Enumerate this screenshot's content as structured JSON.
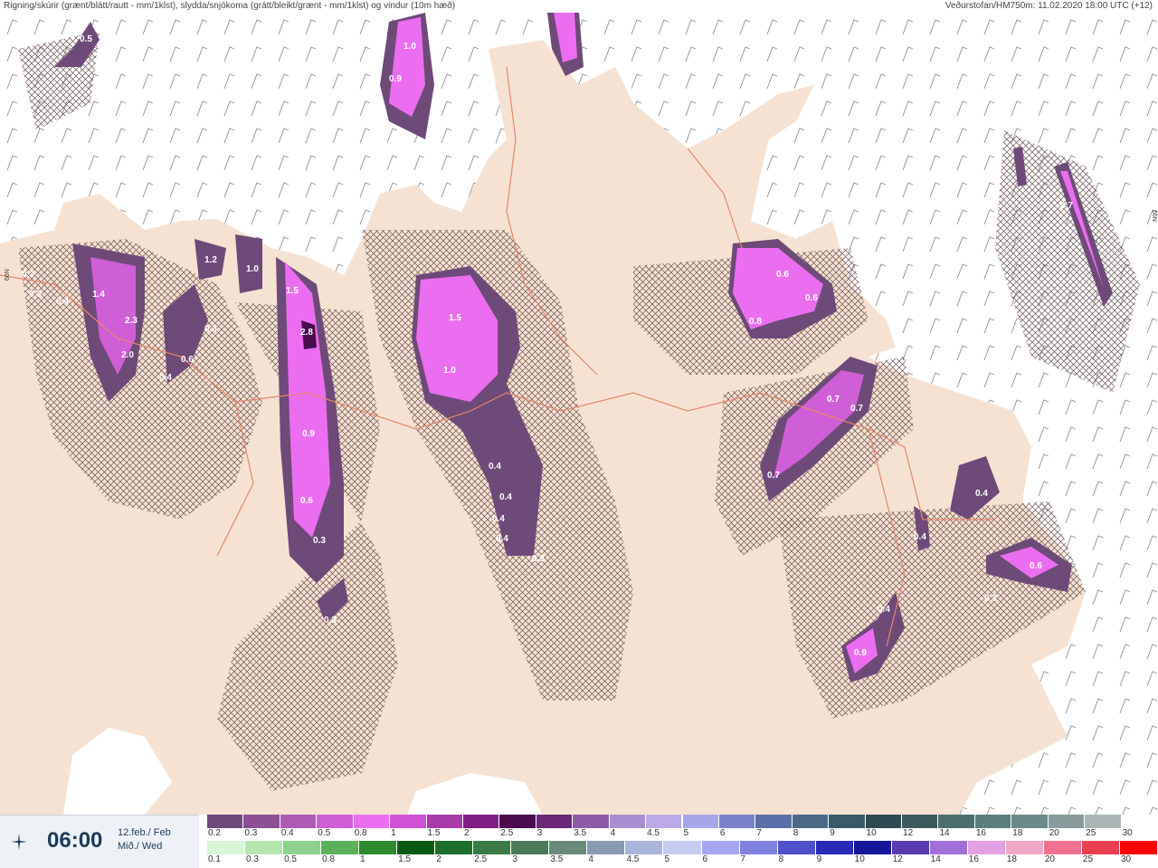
{
  "header": {
    "title": "Rigning/skúrir (grænt/blátt/rautt - mm/1klst), slydda/snjókoma (grátt/bleikt/grænt - mm/1klst) og vindur (10m hæð)",
    "source": "Veðurstofan/HM750m: 11.02.2020 18:00 UTC (+12)"
  },
  "time_panel": {
    "time": "06:00",
    "date_line1": "12.feb./ Feb",
    "date_line2": "Mið./ Wed",
    "icon": "crosshair-star-icon"
  },
  "map": {
    "land_color": "#f5e2d3",
    "sea_color": "#ffffff",
    "snow_color": "#7a4a7a",
    "lat_label": "66N",
    "precip_labels": [
      "0.5",
      "1.0",
      "0.9",
      "0.3",
      "0.3",
      "0.4",
      "1.4",
      "2.3",
      "2.0",
      "1.2",
      "1.0",
      "0.3",
      "0.6",
      "0.4",
      "1.5",
      "2.8",
      "0.9",
      "0.6",
      "0.3",
      "0.3",
      "1.5",
      "1.0",
      "0.4",
      "0.4",
      "0.4",
      "0.4",
      "0.3",
      "0.6",
      "0.6",
      "0.8",
      "0.7",
      "0.7",
      "0.7",
      "0.7",
      "0.4",
      "0.4",
      "0.6",
      "0.3",
      "0.4",
      "0.9",
      "0.5"
    ]
  },
  "scale_top": {
    "labels": [
      "0.2",
      "0.3",
      "0.4",
      "0.5",
      "0.8",
      "1",
      "1.5",
      "2",
      "2.5",
      "3",
      "3.5",
      "4",
      "4.5",
      "5",
      "6",
      "7",
      "8",
      "9",
      "10",
      "12",
      "14",
      "16",
      "18",
      "20",
      "25",
      "30"
    ],
    "colors": [
      "#6e4a78",
      "#8c4f94",
      "#ad5bb5",
      "#cf5fd6",
      "#ec6ef0",
      "#d050d6",
      "#a83aaa",
      "#801e86",
      "#4a0a4e",
      "#6a2876",
      "#8e5aa6",
      "#a88ed0",
      "#bcaae6",
      "#a6a6e8",
      "#7a80c8",
      "#5a6ea8",
      "#4a6a88",
      "#3a5a6a",
      "#2e4a52",
      "#3c5a5e",
      "#4c6e6e",
      "#5a7e7e",
      "#6a8a8a",
      "#889a9a",
      "#aab6b6",
      "#ffffff"
    ]
  },
  "scale_bottom": {
    "labels": [
      "0.1",
      "0.3",
      "0.5",
      "0.8",
      "1",
      "1.5",
      "2",
      "2.5",
      "3",
      "3.5",
      "4",
      "4.5",
      "5",
      "6",
      "7",
      "8",
      "9",
      "10",
      "12",
      "14",
      "16",
      "18",
      "20",
      "25",
      "30"
    ],
    "colors": [
      "#d8f5d8",
      "#b6e6b0",
      "#8ed08c",
      "#5cb05c",
      "#2e8a2e",
      "#0a5a14",
      "#1e6e2e",
      "#3a7a44",
      "#4a7a5a",
      "#6a8a7a",
      "#8a9ab0",
      "#a8b4d8",
      "#c6ccf0",
      "#a6a6f0",
      "#8080e0",
      "#5050cc",
      "#2a2ab8",
      "#16169a",
      "#5a3ab0",
      "#a070d8",
      "#e4a0e4",
      "#f0a8c8",
      "#f07090",
      "#e84050",
      "#ff0000"
    ]
  }
}
